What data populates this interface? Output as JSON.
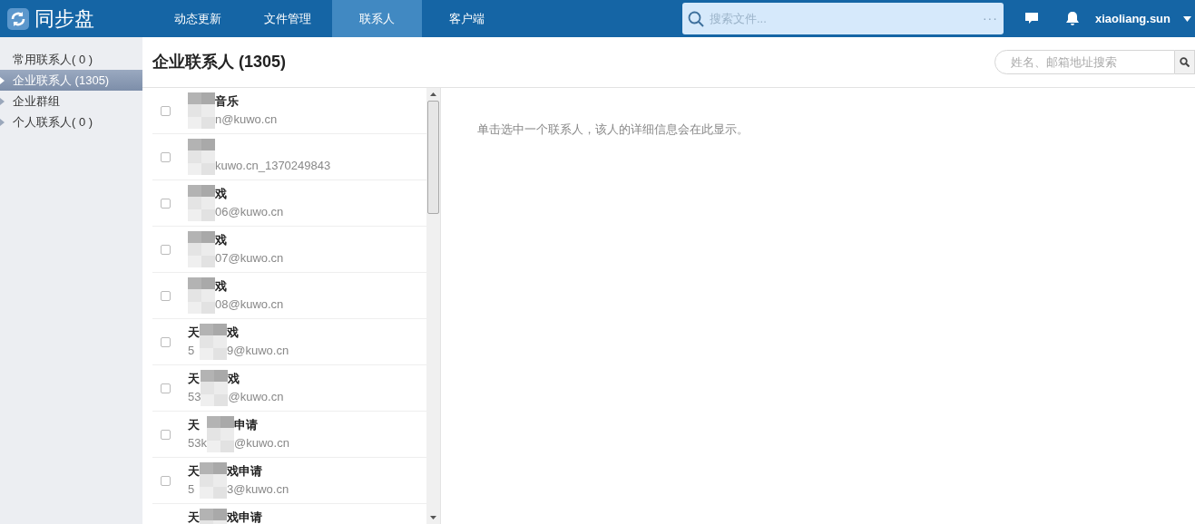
{
  "topbar": {
    "logo": "同步盘",
    "nav": [
      {
        "label": "动态更新",
        "selected": false
      },
      {
        "label": "文件管理",
        "selected": false
      },
      {
        "label": "联系人",
        "selected": true
      },
      {
        "label": "客户端",
        "selected": false
      }
    ],
    "search": {
      "placeholder": "搜索文件...",
      "more": "···"
    },
    "user": "xiaoliang.sun"
  },
  "sidebar": {
    "items": [
      {
        "label": "常用联系人( 0 )",
        "selected": false,
        "expandable": false
      },
      {
        "label": "企业联系人 (1305)",
        "selected": true,
        "expandable": true
      },
      {
        "label": "企业群组",
        "selected": false,
        "expandable": true
      },
      {
        "label": "个人联系人( 0 )",
        "selected": false,
        "expandable": true
      }
    ]
  },
  "header": {
    "title": "企业联系人 (1305)",
    "search": {
      "placeholder": "姓名、邮箱地址搜索"
    }
  },
  "contacts": [
    {
      "name_end": "音乐",
      "email_end": "n@kuwo.cn",
      "checked": false
    },
    {
      "email_end": "kuwo.cn_1370249843",
      "checked": false
    },
    {
      "name_end": "戏",
      "email_end": "06@kuwo.cn",
      "checked": false
    },
    {
      "name_end": "戏",
      "email_end": "07@kuwo.cn",
      "checked": false
    },
    {
      "name_end": "戏",
      "email_end": "08@kuwo.cn",
      "checked": false
    },
    {
      "name_start": "天",
      "name_end": "戏",
      "email_start": "5",
      "email_end": "9@kuwo.cn",
      "checked": false
    },
    {
      "name_start": "天",
      "name_end": "戏",
      "email_start": "53",
      "email_end": "@kuwo.cn",
      "checked": false
    },
    {
      "name_start": "天",
      "name_end": "申请",
      "email_start": "53k",
      "email_end": "@kuwo.cn",
      "checked": false
    },
    {
      "name_start": "天",
      "name_end": "戏申请",
      "email_start": "5",
      "email_end": "3@kuwo.cn",
      "checked": false
    },
    {
      "name_start": "天",
      "name_end": "戏申请"
    }
  ],
  "detail": {
    "hint": "单击选中一个联系人，该人的详细信息会在此显示。"
  }
}
